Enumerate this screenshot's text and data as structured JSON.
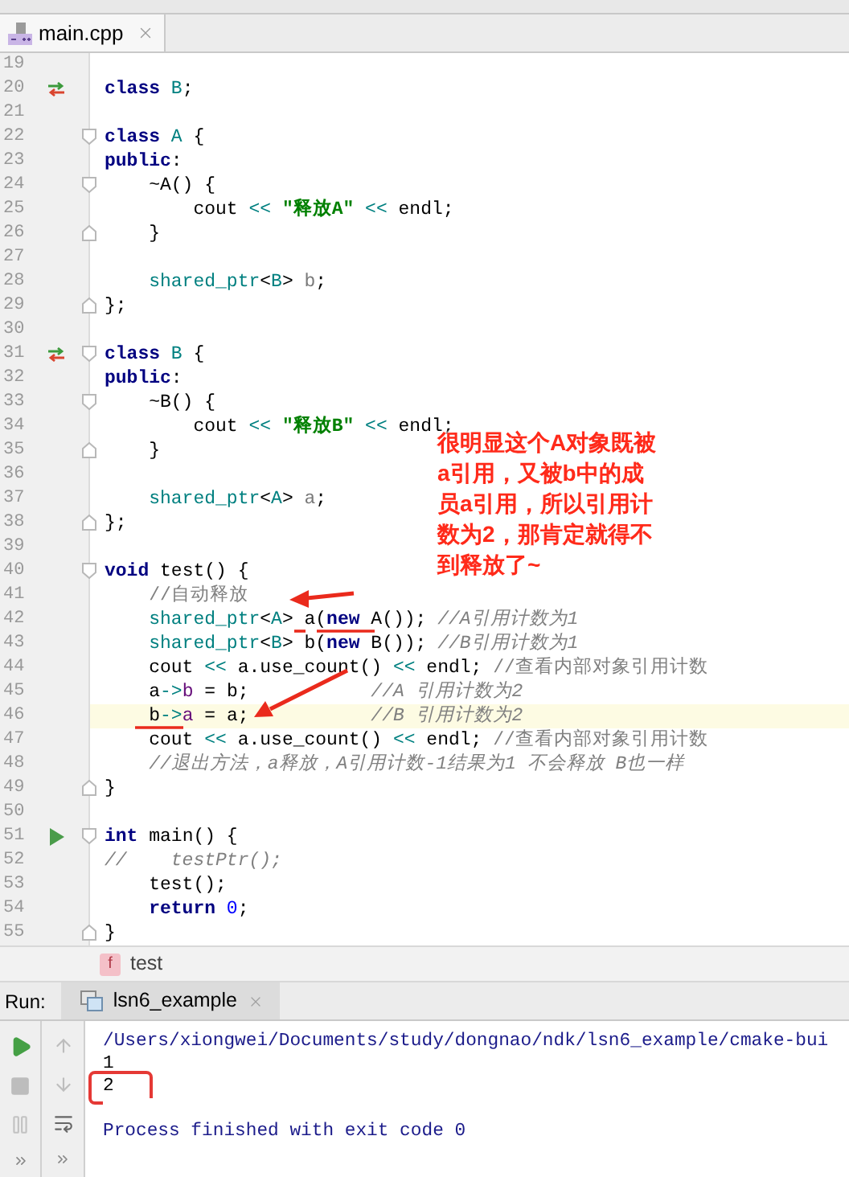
{
  "tabs": [
    {
      "label": "main.cpp",
      "selected": true
    }
  ],
  "editor": {
    "lines": [
      {
        "number": "19",
        "highlighted": false,
        "override_mark": false,
        "run_mark": false,
        "fold_start": false,
        "fold_end": false
      },
      {
        "number": "20",
        "highlighted": false,
        "override_mark": true,
        "run_mark": false,
        "fold_start": false,
        "fold_end": false,
        "tokens": [
          {
            "kind": "keyword",
            "text": "class"
          },
          {
            "kind": "type",
            "text": " B"
          },
          {
            "kind": "plain",
            "text": ";"
          }
        ]
      },
      {
        "number": "21",
        "highlighted": false,
        "override_mark": false,
        "run_mark": false,
        "fold_start": false,
        "fold_end": false
      },
      {
        "number": "22",
        "highlighted": false,
        "override_mark": false,
        "run_mark": false,
        "fold_start": true,
        "fold_end": false,
        "tokens": [
          {
            "kind": "keyword",
            "text": "class"
          },
          {
            "kind": "type",
            "text": " A"
          },
          {
            "kind": "plain",
            "text": " {"
          }
        ]
      },
      {
        "number": "23",
        "highlighted": false,
        "override_mark": false,
        "run_mark": false,
        "fold_start": false,
        "fold_end": false,
        "tokens": [
          {
            "kind": "keyword",
            "text": "public"
          },
          {
            "kind": "plain",
            "text": ":"
          }
        ]
      },
      {
        "number": "24",
        "highlighted": false,
        "override_mark": false,
        "run_mark": false,
        "fold_start": true,
        "fold_end": false,
        "tokens": [
          {
            "kind": "plain",
            "text": "    ~A() {"
          }
        ]
      },
      {
        "number": "25",
        "highlighted": false,
        "override_mark": false,
        "run_mark": false,
        "fold_start": false,
        "fold_end": false,
        "tokens": [
          {
            "kind": "plain",
            "text": "        cout"
          },
          {
            "kind": "operator",
            "text": " <<"
          },
          {
            "kind": "string",
            "text": " \"释放A\""
          },
          {
            "kind": "operator",
            "text": " <<"
          },
          {
            "kind": "plain",
            "text": " endl;"
          }
        ]
      },
      {
        "number": "26",
        "highlighted": false,
        "override_mark": false,
        "run_mark": false,
        "fold_start": false,
        "fold_end": true,
        "tokens": [
          {
            "kind": "plain",
            "text": "    }"
          }
        ]
      },
      {
        "number": "27",
        "highlighted": false,
        "override_mark": false,
        "run_mark": false,
        "fold_start": false,
        "fold_end": false
      },
      {
        "number": "28",
        "highlighted": false,
        "override_mark": false,
        "run_mark": false,
        "fold_start": false,
        "fold_end": false,
        "tokens": [
          {
            "kind": "type",
            "text": "    shared_ptr"
          },
          {
            "kind": "plain",
            "text": "<"
          },
          {
            "kind": "type",
            "text": "B"
          },
          {
            "kind": "plain",
            "text": ">"
          },
          {
            "kind": "field",
            "text": " b"
          },
          {
            "kind": "plain",
            "text": ";"
          }
        ]
      },
      {
        "number": "29",
        "highlighted": false,
        "override_mark": false,
        "run_mark": false,
        "fold_start": false,
        "fold_end": true,
        "tokens": [
          {
            "kind": "plain",
            "text": "};"
          }
        ]
      },
      {
        "number": "30",
        "highlighted": false,
        "override_mark": false,
        "run_mark": false,
        "fold_start": false,
        "fold_end": false
      },
      {
        "number": "31",
        "highlighted": false,
        "override_mark": true,
        "run_mark": false,
        "fold_start": true,
        "fold_end": false,
        "tokens": [
          {
            "kind": "keyword",
            "text": "class"
          },
          {
            "kind": "type",
            "text": " B"
          },
          {
            "kind": "plain",
            "text": " {"
          }
        ]
      },
      {
        "number": "32",
        "highlighted": false,
        "override_mark": false,
        "run_mark": false,
        "fold_start": false,
        "fold_end": false,
        "tokens": [
          {
            "kind": "keyword",
            "text": "public"
          },
          {
            "kind": "plain",
            "text": ":"
          }
        ]
      },
      {
        "number": "33",
        "highlighted": false,
        "override_mark": false,
        "run_mark": false,
        "fold_start": true,
        "fold_end": false,
        "tokens": [
          {
            "kind": "plain",
            "text": "    ~B() {"
          }
        ]
      },
      {
        "number": "34",
        "highlighted": false,
        "override_mark": false,
        "run_mark": false,
        "fold_start": false,
        "fold_end": false,
        "tokens": [
          {
            "kind": "plain",
            "text": "        cout"
          },
          {
            "kind": "operator",
            "text": " <<"
          },
          {
            "kind": "string",
            "text": " \"释放B\""
          },
          {
            "kind": "operator",
            "text": " <<"
          },
          {
            "kind": "plain",
            "text": " endl;"
          }
        ]
      },
      {
        "number": "35",
        "highlighted": false,
        "override_mark": false,
        "run_mark": false,
        "fold_start": false,
        "fold_end": true,
        "tokens": [
          {
            "kind": "plain",
            "text": "    }"
          }
        ]
      },
      {
        "number": "36",
        "highlighted": false,
        "override_mark": false,
        "run_mark": false,
        "fold_start": false,
        "fold_end": false
      },
      {
        "number": "37",
        "highlighted": false,
        "override_mark": false,
        "run_mark": false,
        "fold_start": false,
        "fold_end": false,
        "tokens": [
          {
            "kind": "type",
            "text": "    shared_ptr"
          },
          {
            "kind": "plain",
            "text": "<"
          },
          {
            "kind": "type",
            "text": "A"
          },
          {
            "kind": "plain",
            "text": ">"
          },
          {
            "kind": "field",
            "text": " a"
          },
          {
            "kind": "plain",
            "text": ";"
          }
        ]
      },
      {
        "number": "38",
        "highlighted": false,
        "override_mark": false,
        "run_mark": false,
        "fold_start": false,
        "fold_end": true,
        "tokens": [
          {
            "kind": "plain",
            "text": "};"
          }
        ]
      },
      {
        "number": "39",
        "highlighted": false,
        "override_mark": false,
        "run_mark": false,
        "fold_start": false,
        "fold_end": false
      },
      {
        "number": "40",
        "highlighted": false,
        "override_mark": false,
        "run_mark": false,
        "fold_start": true,
        "fold_end": false,
        "tokens": [
          {
            "kind": "keyword",
            "text": "void"
          },
          {
            "kind": "plain",
            "text": " test() {"
          }
        ]
      },
      {
        "number": "41",
        "highlighted": false,
        "override_mark": false,
        "run_mark": false,
        "fold_start": false,
        "fold_end": false,
        "tokens": [
          {
            "kind": "comment",
            "text": "    //自动释放"
          }
        ]
      },
      {
        "number": "42",
        "highlighted": false,
        "override_mark": false,
        "run_mark": false,
        "fold_start": false,
        "fold_end": false,
        "tokens": [
          {
            "kind": "type",
            "text": "    shared_ptr"
          },
          {
            "kind": "plain",
            "text": "<"
          },
          {
            "kind": "type",
            "text": "A"
          },
          {
            "kind": "plain",
            "text": "> a("
          },
          {
            "kind": "keyword",
            "text": "new"
          },
          {
            "kind": "plain",
            "text": " A());"
          },
          {
            "kind": "italic_comment",
            "text": " //A引用计数为1"
          }
        ]
      },
      {
        "number": "43",
        "highlighted": false,
        "override_mark": false,
        "run_mark": false,
        "fold_start": false,
        "fold_end": false,
        "tokens": [
          {
            "kind": "type",
            "text": "    shared_ptr"
          },
          {
            "kind": "plain",
            "text": "<"
          },
          {
            "kind": "type",
            "text": "B"
          },
          {
            "kind": "plain",
            "text": "> b("
          },
          {
            "kind": "keyword",
            "text": "new"
          },
          {
            "kind": "plain",
            "text": " B());"
          },
          {
            "kind": "italic_comment",
            "text": " //B引用计数为1"
          }
        ]
      },
      {
        "number": "44",
        "highlighted": false,
        "override_mark": false,
        "run_mark": false,
        "fold_start": false,
        "fold_end": false,
        "tokens": [
          {
            "kind": "plain",
            "text": "    cout"
          },
          {
            "kind": "operator",
            "text": " <<"
          },
          {
            "kind": "plain",
            "text": " a.use_count()"
          },
          {
            "kind": "operator",
            "text": " <<"
          },
          {
            "kind": "plain",
            "text": " endl;"
          },
          {
            "kind": "comment",
            "text": " //查看内部对象引用计数"
          }
        ]
      },
      {
        "number": "45",
        "highlighted": false,
        "override_mark": false,
        "run_mark": false,
        "fold_start": false,
        "fold_end": false,
        "tokens": [
          {
            "kind": "plain",
            "text": "    a"
          },
          {
            "kind": "operator",
            "text": "->"
          },
          {
            "kind": "member",
            "text": "b"
          },
          {
            "kind": "plain",
            "text": " = b;"
          },
          {
            "kind": "italic_comment",
            "text": "           //A 引用计数为2"
          }
        ]
      },
      {
        "number": "46",
        "highlighted": true,
        "override_mark": false,
        "run_mark": false,
        "fold_start": false,
        "fold_end": false,
        "tokens": [
          {
            "kind": "plain",
            "text": "    b"
          },
          {
            "kind": "operator",
            "text": "->"
          },
          {
            "kind": "member",
            "text": "a"
          },
          {
            "kind": "plain",
            "text": " = a;"
          },
          {
            "kind": "italic_comment",
            "text": "           //B 引用计数为2"
          }
        ]
      },
      {
        "number": "47",
        "highlighted": false,
        "override_mark": false,
        "run_mark": false,
        "fold_start": false,
        "fold_end": false,
        "tokens": [
          {
            "kind": "plain",
            "text": "    cout"
          },
          {
            "kind": "operator",
            "text": " <<"
          },
          {
            "kind": "plain",
            "text": " a.use_count()"
          },
          {
            "kind": "operator",
            "text": " <<"
          },
          {
            "kind": "plain",
            "text": " endl;"
          },
          {
            "kind": "comment",
            "text": " //查看内部对象引用计数"
          }
        ]
      },
      {
        "number": "48",
        "highlighted": false,
        "override_mark": false,
        "run_mark": false,
        "fold_start": false,
        "fold_end": false,
        "tokens": [
          {
            "kind": "italic_comment",
            "text": "    //退出方法，a释放，A引用计数-1结果为1 不会释放 B也一样"
          }
        ]
      },
      {
        "number": "49",
        "highlighted": false,
        "override_mark": false,
        "run_mark": false,
        "fold_start": false,
        "fold_end": true,
        "tokens": [
          {
            "kind": "plain",
            "text": "}"
          }
        ]
      },
      {
        "number": "50",
        "highlighted": false,
        "override_mark": false,
        "run_mark": false,
        "fold_start": false,
        "fold_end": false
      },
      {
        "number": "51",
        "highlighted": false,
        "override_mark": false,
        "run_mark": true,
        "fold_start": true,
        "fold_end": false,
        "tokens": [
          {
            "kind": "keyword",
            "text": "int"
          },
          {
            "kind": "plain",
            "text": " main() {"
          }
        ]
      },
      {
        "number": "52",
        "highlighted": false,
        "override_mark": false,
        "run_mark": false,
        "fold_start": false,
        "fold_end": false,
        "tokens": [
          {
            "kind": "italic_comment",
            "text": "//    testPtr();"
          }
        ]
      },
      {
        "number": "53",
        "highlighted": false,
        "override_mark": false,
        "run_mark": false,
        "fold_start": false,
        "fold_end": false,
        "tokens": [
          {
            "kind": "plain",
            "text": "    test();"
          }
        ]
      },
      {
        "number": "54",
        "highlighted": false,
        "override_mark": false,
        "run_mark": false,
        "fold_start": false,
        "fold_end": false,
        "tokens": [
          {
            "kind": "keyword",
            "text": "    return"
          },
          {
            "kind": "number",
            "text": " 0"
          },
          {
            "kind": "plain",
            "text": ";"
          }
        ]
      },
      {
        "number": "55",
        "highlighted": false,
        "override_mark": false,
        "run_mark": false,
        "fold_start": false,
        "fold_end": true,
        "tokens": [
          {
            "kind": "plain",
            "text": "}"
          }
        ]
      }
    ]
  },
  "annotation": {
    "text": "很明显这个A对象既被a引用，又被b中的成员a引用，所以引用计数为2，那肯定就得不到释放了~"
  },
  "breadcrumb": {
    "badge": "f",
    "label": "test"
  },
  "run_panel": {
    "title": "Run:",
    "tabs": [
      {
        "label": "lsn6_example",
        "selected": true
      }
    ],
    "output": [
      {
        "kind": "system",
        "text": "/Users/xiongwei/Documents/study/dongnao/ndk/lsn6_example/cmake-bui",
        "circled": false
      },
      {
        "kind": "stdout",
        "text": "1",
        "circled": false
      },
      {
        "kind": "stdout",
        "text": "2",
        "circled": true
      },
      {
        "kind": "blank",
        "circled": false
      },
      {
        "kind": "system",
        "text": "Process finished with exit code 0",
        "circled": false
      }
    ]
  }
}
